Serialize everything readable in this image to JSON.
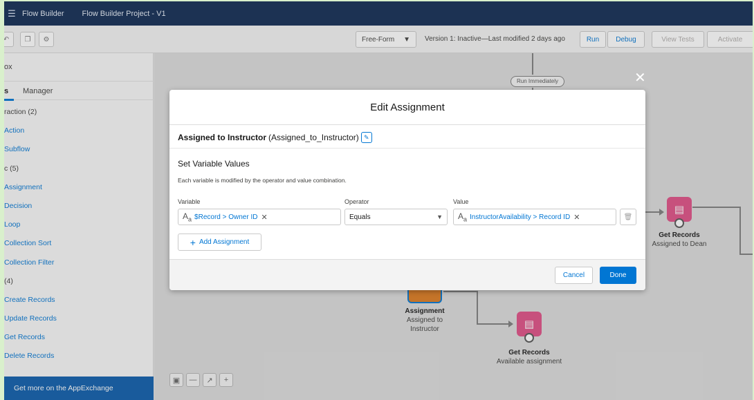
{
  "topbar": {
    "app_name": "Flow Builder",
    "project_title": "Flow Builder Project - V1"
  },
  "toolbar": {
    "layout_mode": "Free-Form",
    "version_text": "Version 1: Inactive—Last modified 2 days ago",
    "run_label": "Run",
    "debug_label": "Debug",
    "view_tests_label": "View Tests",
    "activate_label": "Activate"
  },
  "sidebar": {
    "title": "ox",
    "tab_active": "s",
    "tab_other": "Manager",
    "items": [
      {
        "label": "raction (2)",
        "kind": "group"
      },
      {
        "label": "Action",
        "kind": "element"
      },
      {
        "label": "Subflow",
        "kind": "element"
      },
      {
        "label": "c (5)",
        "kind": "group"
      },
      {
        "label": "Assignment",
        "kind": "element"
      },
      {
        "label": "Decision",
        "kind": "element"
      },
      {
        "label": "Loop",
        "kind": "element"
      },
      {
        "label": "Collection Sort",
        "kind": "element"
      },
      {
        "label": "Collection Filter",
        "kind": "element"
      },
      {
        "label": "(4)",
        "kind": "group"
      },
      {
        "label": "Create Records",
        "kind": "element"
      },
      {
        "label": "Update Records",
        "kind": "element"
      },
      {
        "label": "Get Records",
        "kind": "element"
      },
      {
        "label": "Delete Records",
        "kind": "element"
      }
    ],
    "footer": "Get more on the AppExchange"
  },
  "canvas": {
    "run_immediately": "Run Immediately",
    "node_assignment": {
      "title": "Assignment",
      "line1": "Assigned to",
      "line2": "Instructor"
    },
    "node_get_available": {
      "title": "Get Records",
      "subtitle": "Available assignment"
    },
    "node_get_dean": {
      "title": "Get Records",
      "subtitle": "Assigned to Dean"
    }
  },
  "modal": {
    "title": "Edit Assignment",
    "element_label": "Assigned to Instructor",
    "element_api": "(Assigned_to_Instructor)",
    "section_title": "Set Variable Values",
    "section_desc": "Each variable is modified by the operator and value combination.",
    "col_variable": "Variable",
    "col_operator": "Operator",
    "col_value": "Value",
    "row": {
      "variable": "$Record > Owner ID",
      "operator": "Equals",
      "value": "InstructorAvailability > Record ID"
    },
    "add_label": "Add Assignment",
    "cancel_label": "Cancel",
    "done_label": "Done"
  },
  "colors": {
    "topbar": "#0f2a52",
    "brand_blue": "#0176d3",
    "node_pink": "#e04f85",
    "sidebar_footer": "#0b5cab"
  },
  "icons": [
    "flow-logo-icon",
    "undo-icon",
    "copy-icon",
    "settings-icon",
    "chevron-down-icon",
    "edit-icon",
    "text-type-icon",
    "remove-icon",
    "trash-icon",
    "plus-icon",
    "close-icon",
    "get-records-icon",
    "fit-view-icon",
    "zoom-out-icon",
    "expand-icon",
    "zoom-in-icon"
  ]
}
